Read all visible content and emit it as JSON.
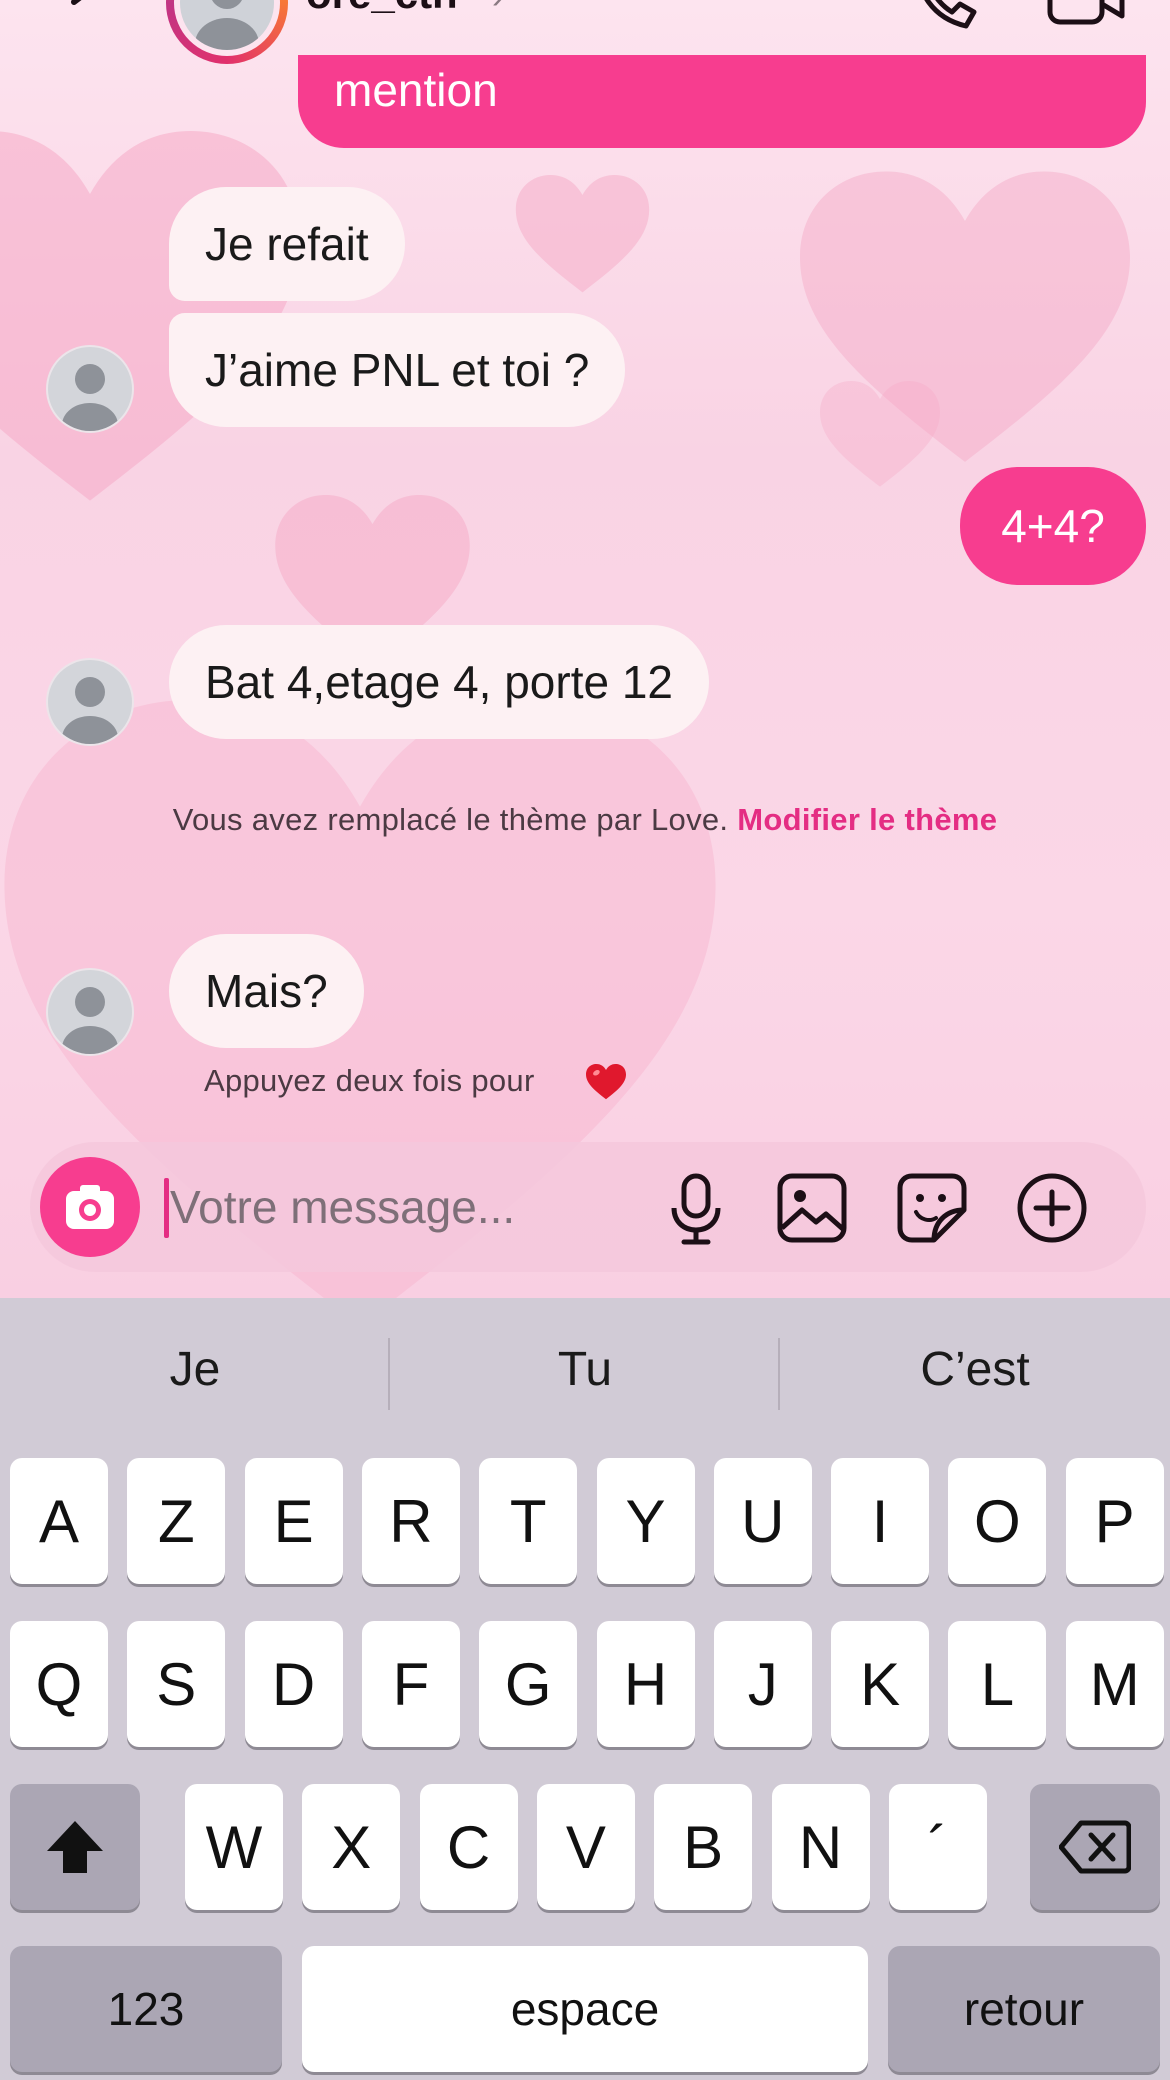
{
  "header": {
    "username": "ore_cth",
    "chevron": "›"
  },
  "messages": {
    "outgoing_top": "mention",
    "in1": "Je refait",
    "in2": "J’aime PNL et toi ?",
    "out1": "4+4?",
    "in3": "Bat 4,etage 4, porte 12",
    "in4": "Mais?"
  },
  "system_message": {
    "text": "Vous avez remplacé le thème par Love. ",
    "link": "Modifier le thème"
  },
  "hint": "Appuyez deux fois pour",
  "composer": {
    "placeholder": "Votre message..."
  },
  "keyboard": {
    "suggestions": [
      "Je",
      "Tu",
      "C’est"
    ],
    "row1": [
      "A",
      "Z",
      "E",
      "R",
      "T",
      "Y",
      "U",
      "I",
      "O",
      "P"
    ],
    "row2": [
      "Q",
      "S",
      "D",
      "F",
      "G",
      "H",
      "J",
      "K",
      "L",
      "M"
    ],
    "row3": [
      "W",
      "X",
      "C",
      "V",
      "B",
      "N",
      "´"
    ],
    "numbers": "123",
    "space": "espace",
    "return": "retour"
  },
  "colors": {
    "accent": "#f73d8f",
    "link": "#e42d83",
    "incoming_bubble": "#fdf1f3"
  },
  "icons": [
    "back-arrow-icon",
    "phone-icon",
    "video-camera-icon",
    "camera-icon",
    "microphone-icon",
    "gallery-icon",
    "sticker-icon",
    "plus-circle-icon",
    "shift-icon",
    "backspace-icon",
    "heart-emoji-icon"
  ]
}
